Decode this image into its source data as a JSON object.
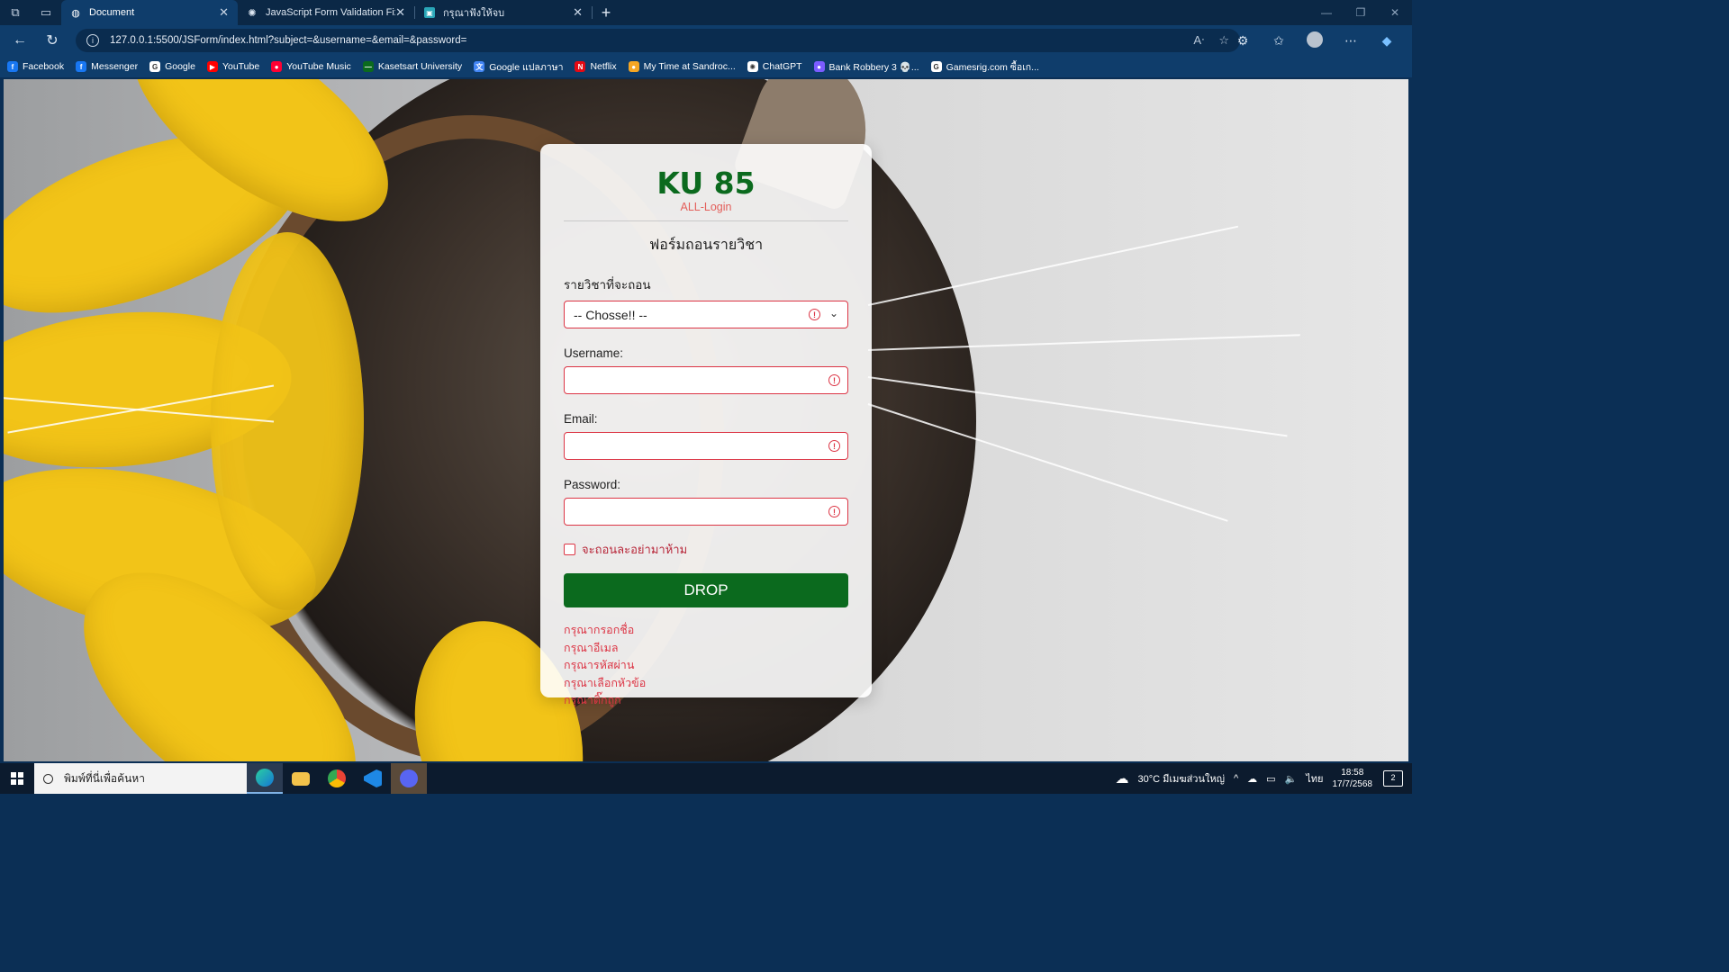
{
  "browser": {
    "tabs": [
      {
        "title": "Document",
        "active": true,
        "icon": "globe-icon"
      },
      {
        "title": "JavaScript Form Validation Fix",
        "active": false,
        "icon": "chatgpt-icon"
      },
      {
        "title": "กรุณาฟังให้จบ",
        "active": false,
        "icon": "image-icon"
      }
    ],
    "url": "127.0.0.1:5500/JSForm/index.html?subject=&username=&email=&password=",
    "bookmarks": [
      {
        "label": "Facebook",
        "color": "#1877f2",
        "glyph": "f"
      },
      {
        "label": "Messenger",
        "color": "#1877f2",
        "glyph": "f"
      },
      {
        "label": "Google",
        "color": "#ffffff",
        "glyph": "G"
      },
      {
        "label": "YouTube",
        "color": "#ff0000",
        "glyph": "▶"
      },
      {
        "label": "YouTube Music",
        "color": "#ff0033",
        "glyph": "●"
      },
      {
        "label": "Kasetsart University",
        "color": "#0b6a1e",
        "glyph": "—"
      },
      {
        "label": "Google แปลภาษา",
        "color": "#4285f4",
        "glyph": "文"
      },
      {
        "label": "Netflix",
        "color": "#e50914",
        "glyph": "N"
      },
      {
        "label": "My Time at Sandroc...",
        "color": "#f5a623",
        "glyph": "●"
      },
      {
        "label": "ChatGPT",
        "color": "#ffffff",
        "glyph": "✺"
      },
      {
        "label": "Bank Robbery 3 💀...",
        "color": "#7b5cff",
        "glyph": "●"
      },
      {
        "label": "Gamesrig.com ซื้อเก...",
        "color": "#ffffff",
        "glyph": "G"
      }
    ]
  },
  "form": {
    "brand": "KU 85",
    "subbrand": "ALL-Login",
    "title": "ฟอร์มถอนรายวิชา",
    "subject_label": "รายวิชาที่จะถอน",
    "subject_value": "-- Chosse!! --",
    "username_label": "Username:",
    "email_label": "Email:",
    "password_label": "Password:",
    "checkbox_label": "จะถอนละอย่ามาห้าม",
    "submit_label": "DROP",
    "errors": [
      "กรุณากรอกชื่อ",
      "กรุณาอีเมล",
      "กรุณารหัสผ่าน",
      "กรุณาเลือกหัวข้อ",
      "กรุณาติ๊กถูก"
    ]
  },
  "taskbar": {
    "search_placeholder": "พิมพ์ที่นี่เพื่อค้นหา",
    "weather": "30°C มีเมฆส่วนใหญ่",
    "language": "ไทย",
    "time": "18:58",
    "date": "17/7/2568",
    "notifications": "2"
  }
}
